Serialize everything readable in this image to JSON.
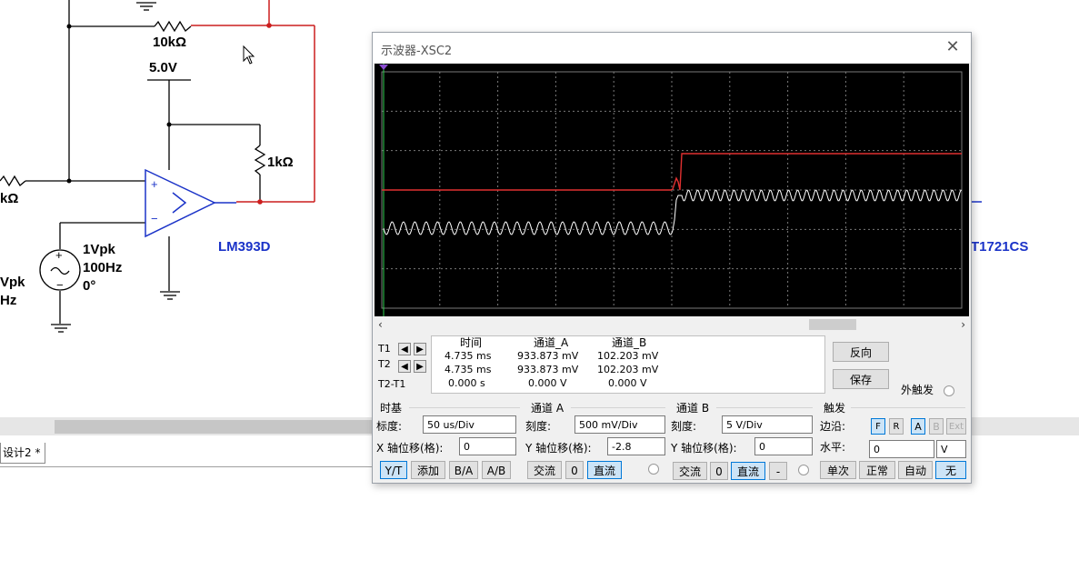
{
  "schematic": {
    "res_top_label": "10kΩ",
    "vcc_label": "5.0V",
    "res_right_label": "1kΩ",
    "res_left_label": "kΩ",
    "source_amp": "1Vpk",
    "source_freq": "100Hz",
    "source_phase": "0°",
    "source2_amp": "Vpk",
    "source2_freq": "Hz",
    "opamp_label": "LM393D",
    "right_part_label": "T1721CS",
    "design_tab": "设计2 *"
  },
  "oscilloscope": {
    "title": "示波器-XSC2",
    "close_icon": "close-icon",
    "trace_colors": {
      "channel_a": "#e03030",
      "channel_b": "#ffffff",
      "grid": "#7a7a7a"
    },
    "readout": {
      "col_time": "时间",
      "col_a": "通道_A",
      "col_b": "通道_B",
      "t1_label": "T1",
      "t2_label": "T2",
      "t2t1_label": "T2-T1",
      "t1_time": "4.735 ms",
      "t1_a": "933.873 mV",
      "t1_b": "102.203 mV",
      "t2_time": "4.735 ms",
      "t2_a": "933.873 mV",
      "t2_b": "102.203 mV",
      "d_time": "0.000 s",
      "d_a": "0.000 V",
      "d_b": "0.000 V"
    },
    "buttons": {
      "reverse": "反向",
      "save": "保存",
      "ext_trigger": "外触发"
    },
    "timebase": {
      "title": "时基",
      "scale_label": "标度:",
      "scale_value": "50 us/Div",
      "xpos_label": "X 轴位移(格):",
      "xpos_value": "0",
      "modes": [
        "Y/T",
        "添加",
        "B/A",
        "A/B"
      ]
    },
    "channel_a": {
      "title": "通道 A",
      "scale_label": "刻度:",
      "scale_value": "500 mV/Div",
      "ypos_label": "Y 轴位移(格):",
      "ypos_value": "-2.8",
      "coupling": [
        "交流",
        "0",
        "直流"
      ]
    },
    "channel_b": {
      "title": "通道 B",
      "scale_label": "刻度:",
      "scale_value": "5  V/Div",
      "ypos_label": "Y 轴位移(格):",
      "ypos_value": "0",
      "coupling": [
        "交流",
        "0",
        "直流",
        "-"
      ]
    },
    "trigger": {
      "title": "触发",
      "edge_label": "边沿:",
      "edge_buttons": [
        "F",
        "R",
        "A",
        "B",
        "Ext"
      ],
      "level_label": "水平:",
      "level_value": "0",
      "level_unit": "V",
      "modes": [
        "单次",
        "正常",
        "自动",
        "无"
      ]
    }
  }
}
